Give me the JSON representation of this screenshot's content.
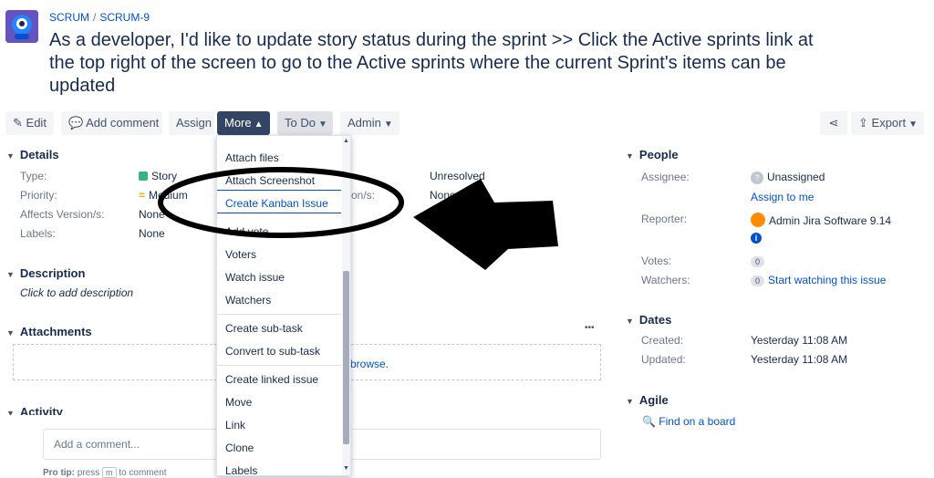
{
  "header": {
    "breadcrumb": {
      "project": "SCRUM",
      "separator": "/",
      "issue_key": "SCRUM-9"
    },
    "title": "As a developer, I'd like to update story status during the sprint >> Click the Active sprints link at the top right of the screen to go to the Active sprints where the current Sprint's items can be updated"
  },
  "toolbar": {
    "edit": "Edit",
    "add_comment": "Add comment",
    "assign": "Assign",
    "more": "More",
    "status": "To Do",
    "admin": "Admin",
    "export": "Export"
  },
  "details": {
    "heading": "Details",
    "type_label": "Type:",
    "type_value": "Story",
    "priority_label": "Priority:",
    "priority_value": "Medium",
    "affects_label": "Affects Version/s:",
    "affects_value": "None",
    "labels_label": "Labels:",
    "labels_value": "None",
    "resolution_value": "Unresolved",
    "fix_label": "on/s:",
    "fix_value": "None"
  },
  "description": {
    "heading": "Description",
    "placeholder": "Click to add description"
  },
  "attachments": {
    "heading": "Attachments",
    "more": "•••",
    "browse": "browse."
  },
  "activity": {
    "heading": "Activity",
    "comment_placeholder": "Add a comment...",
    "pro_tip_label": "Pro tip:",
    "pro_tip_text": "press",
    "pro_tip_key": "m",
    "pro_tip_suffix": "to comment"
  },
  "people": {
    "heading": "People",
    "assignee_label": "Assignee:",
    "assignee_value": "Unassigned",
    "assign_to_me": "Assign to me",
    "reporter_label": "Reporter:",
    "reporter_value": "Admin Jira Software 9.14",
    "votes_label": "Votes:",
    "votes_count": "0",
    "watchers_label": "Watchers:",
    "watchers_count": "0",
    "watch_link": "Start watching this issue"
  },
  "dates": {
    "heading": "Dates",
    "created_label": "Created:",
    "created_value": "Yesterday 11:08 AM",
    "updated_label": "Updated:",
    "updated_value": "Yesterday 11:08 AM"
  },
  "agile": {
    "heading": "Agile",
    "find_board": "Find on a board"
  },
  "more_menu": {
    "items": [
      "Attach files",
      "Attach Screenshot",
      "Create Kanban Issue",
      "Add vote",
      "Voters",
      "Watch issue",
      "Watchers",
      "Create sub-task",
      "Convert to sub-task",
      "Create linked issue",
      "Move",
      "Link",
      "Clone",
      "Labels"
    ]
  },
  "colors": {
    "brand": "#0052cc",
    "toolbar_active": "#344563",
    "annotation": "#000000"
  }
}
